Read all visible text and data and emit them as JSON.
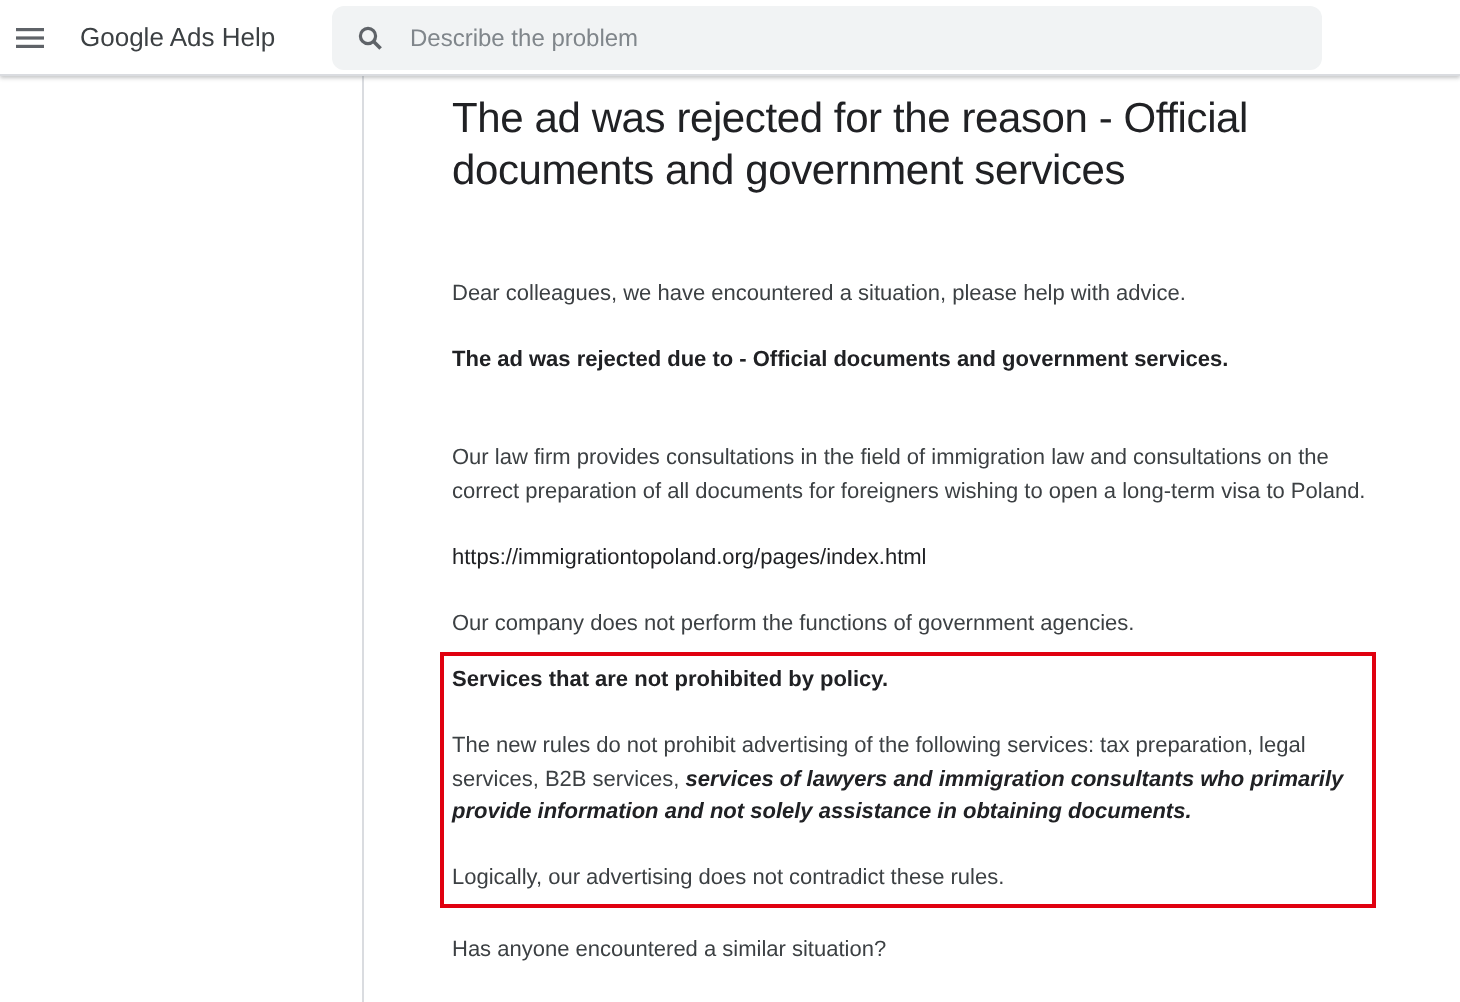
{
  "header": {
    "app_title": "Google Ads Help",
    "search": {
      "placeholder": "Describe the problem"
    }
  },
  "post": {
    "title": "The ad was rejected for the reason - Official documents and government services",
    "greeting": "Dear colleagues, we have encountered a situation, please help with advice.",
    "rejection_reason": "The ad was rejected due to - Official documents and government services.",
    "body": [
      {
        "kind": "text",
        "text": "Our law firm provides consultations in the field of immigration law and consultations on the correct preparation of all documents for foreigners wishing to open a long-term visa to Poland."
      },
      {
        "kind": "url",
        "text": "https://immigrationtopoland.org/pages/index.html"
      },
      {
        "kind": "text",
        "text": "Our company does not perform the functions of government agencies."
      }
    ],
    "highlighted_box": {
      "heading": "Services that are not prohibited by policy.",
      "paragraphs": [
        "The new rules do not prohibit advertising of the following services: tax preparation, legal services, B2B services, **services of lawyers and immigration consultants who primarily provide information and not solely assistance in obtaining documents.**",
        "Logically, our advertising does not contradict these rules."
      ]
    },
    "closing_question": "Has anyone encountered a similar situation?"
  }
}
